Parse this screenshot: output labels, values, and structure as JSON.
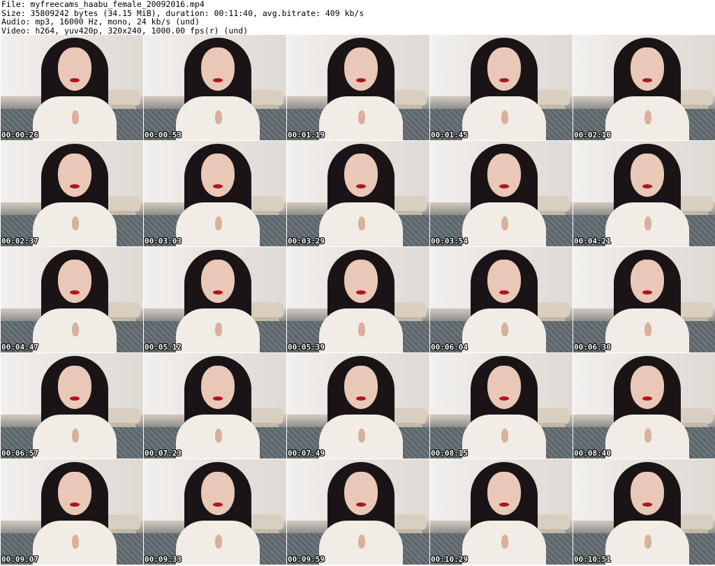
{
  "header": {
    "file": "File: myfreecams_haabu_female_20092016.mp4",
    "size": "Size: 35809242 bytes (34.15 MiB), duration: 00:11:40, avg.bitrate: 409 kb/s",
    "audio": "Audio: mp3, 16000 Hz, mono, 24 kb/s (und)",
    "video": "Video: h264, yuv420p, 320x240, 1000.00 fps(r) (und)"
  },
  "thumbnails": [
    {
      "timestamp": "00:00:26"
    },
    {
      "timestamp": "00:00:53"
    },
    {
      "timestamp": "00:01:19"
    },
    {
      "timestamp": "00:01:45"
    },
    {
      "timestamp": "00:02:10"
    },
    {
      "timestamp": "00:02:37"
    },
    {
      "timestamp": "00:03:03"
    },
    {
      "timestamp": "00:03:29"
    },
    {
      "timestamp": "00:03:54"
    },
    {
      "timestamp": "00:04:21"
    },
    {
      "timestamp": "00:04:47"
    },
    {
      "timestamp": "00:05:12"
    },
    {
      "timestamp": "00:05:39"
    },
    {
      "timestamp": "00:06:04"
    },
    {
      "timestamp": "00:06:30"
    },
    {
      "timestamp": "00:06:57"
    },
    {
      "timestamp": "00:07:23"
    },
    {
      "timestamp": "00:07:49"
    },
    {
      "timestamp": "00:08:15"
    },
    {
      "timestamp": "00:08:40"
    },
    {
      "timestamp": "00:09:07"
    },
    {
      "timestamp": "00:09:33"
    },
    {
      "timestamp": "00:09:59"
    },
    {
      "timestamp": "00:10:29"
    },
    {
      "timestamp": "00:10:51"
    }
  ]
}
